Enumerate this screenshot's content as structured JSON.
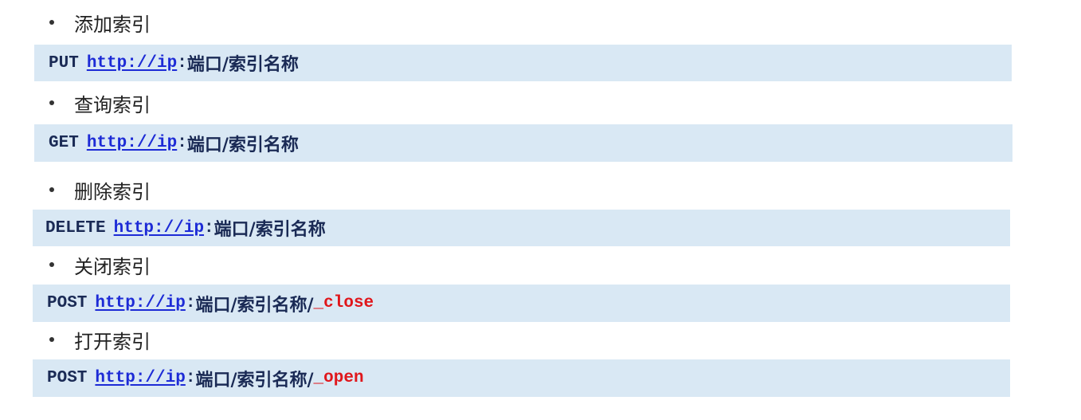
{
  "items": [
    {
      "bullet": "添加索引",
      "method": "PUT",
      "url": "http://ip",
      "colon": ":",
      "path": "端口/索引名称",
      "slash": "",
      "suffix": ""
    },
    {
      "bullet": "查询索引",
      "method": "GET",
      "url": "http://ip",
      "colon": ":",
      "path": "端口/索引名称",
      "slash": "",
      "suffix": ""
    },
    {
      "bullet": "删除索引",
      "method": "DELETE",
      "url": "http://ip",
      "colon": ":",
      "path": "端口/索引名称",
      "slash": "",
      "suffix": ""
    },
    {
      "bullet": "关闭索引",
      "method": "POST",
      "url": "http://ip",
      "colon": ":",
      "path": "端口/索引名称/",
      "slash": "",
      "suffix": "_close"
    },
    {
      "bullet": "打开索引",
      "method": "POST",
      "url": "http://ip",
      "colon": ":",
      "path": "端口/索引名称/",
      "slash": "",
      "suffix": "_open"
    }
  ],
  "colors": {
    "code_background": "#d9e8f4",
    "code_text": "#1a2a55",
    "link": "#1d2bd6",
    "suffix": "#e0161b"
  }
}
